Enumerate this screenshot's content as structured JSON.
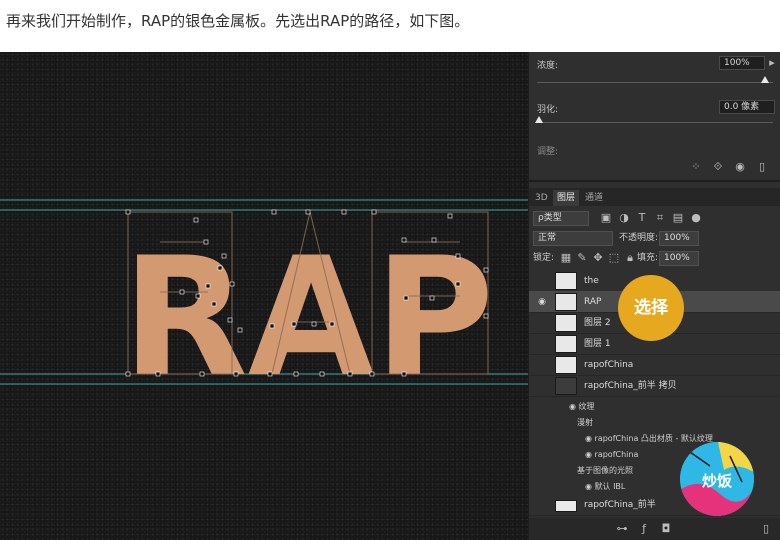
{
  "caption": "再来我们开始制作，RAP的银色金属板。先选出RAP的路径，如下图。",
  "canvas": {
    "text": "RAP",
    "text_color": "#d39a72"
  },
  "properties": {
    "density_label": "浓度:",
    "density_value": "100%",
    "feather_label": "羽化:",
    "feather_value": "0.0 像素",
    "adjust_label": "调整:"
  },
  "layers_panel": {
    "tabs": [
      "3D",
      "图层",
      "通道"
    ],
    "filter_label": "ρ类型",
    "blend_mode": "正常",
    "opacity_label": "不透明度:",
    "opacity_value": "100%",
    "lock_label": "锁定:",
    "fill_label": "填充:",
    "fill_value": "100%",
    "layers": [
      {
        "name": "the",
        "visible": false
      },
      {
        "name": "RAP",
        "visible": true
      },
      {
        "name": "图层 2",
        "visible": false
      },
      {
        "name": "图层 1",
        "visible": false
      },
      {
        "name": "rapofChina",
        "visible": false
      },
      {
        "name": "rapofChina_前半 拷贝",
        "visible": false
      }
    ],
    "sub_items": [
      {
        "label": "纹理",
        "eye": true
      },
      {
        "label": "漫射",
        "eye": false
      },
      {
        "label": "rapofChina 凸出材质 - 默认纹理",
        "eye": true
      },
      {
        "label": "rapofChina",
        "eye": true
      },
      {
        "label": "基于图像的光照",
        "eye": false
      },
      {
        "label": "默认 IBL",
        "eye": true
      }
    ],
    "last_layer_partial": "rapofChina_前半"
  },
  "overlay_badge": "选择",
  "logo_text": "炒饭",
  "colors": {
    "badge": "#e6a81f",
    "panel": "#2f2f2f",
    "guides": "#3ea7a7"
  }
}
